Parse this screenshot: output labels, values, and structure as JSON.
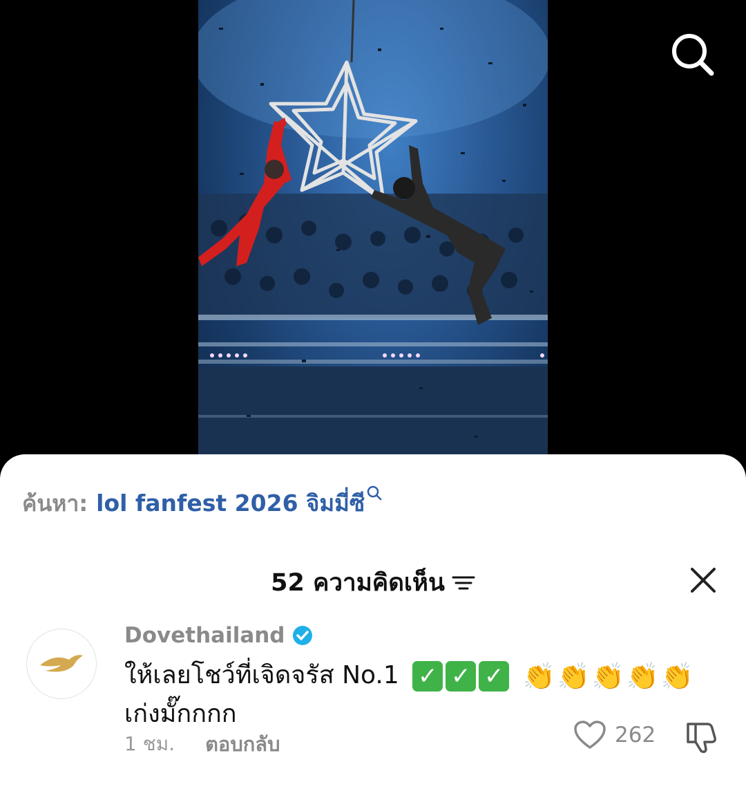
{
  "video": {
    "description_icon": "concert-performance-video"
  },
  "top_bar": {
    "search_icon": "search-icon"
  },
  "search_suggestion": {
    "prefix": "ค้นหา:",
    "query": "lol fanfest 2026 จิมมี่ซี"
  },
  "comments_header": {
    "count_label": "52 ความคิดเห็น"
  },
  "comment": {
    "username": "Dovethailand",
    "verified": true,
    "text_line1": "ให้เลยโชว์ที่เจิดจรัส No.1",
    "emojis_check": [
      "✓",
      "✓",
      "✓"
    ],
    "emojis_clap": [
      "👏",
      "👏",
      "👏",
      "👏",
      "👏"
    ],
    "text_line2": "เก่งมั๊กกกก",
    "time": "1 ชม.",
    "reply_label": "ตอบกลับ",
    "likes": "262"
  },
  "colors": {
    "link_blue": "#2f5fa7",
    "verified_blue": "#20b0e8",
    "check_green": "#3fb347",
    "muted_gray": "#8a8a8a"
  }
}
